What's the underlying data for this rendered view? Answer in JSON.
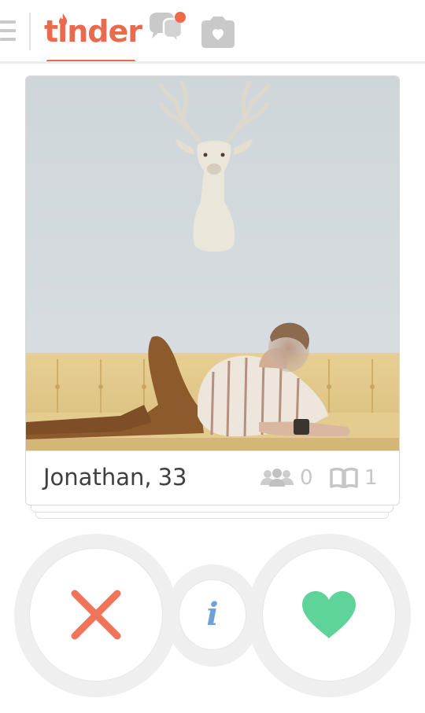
{
  "app": {
    "logo_text": "tinder",
    "brand_color": "#ea6a4e"
  },
  "header": {
    "icons": [
      "menu-icon",
      "chat-icon",
      "camera-icon"
    ],
    "chat_notification": true
  },
  "card": {
    "name": "Jonathan",
    "age": "33",
    "common_friends_count": "0",
    "common_interests_count": "1",
    "photo_description_icon": "profile-photo"
  },
  "actions": {
    "nope_color": "#f0735a",
    "info_label": "i",
    "info_color": "#6ea1d8",
    "like_color": "#5ed39a"
  }
}
